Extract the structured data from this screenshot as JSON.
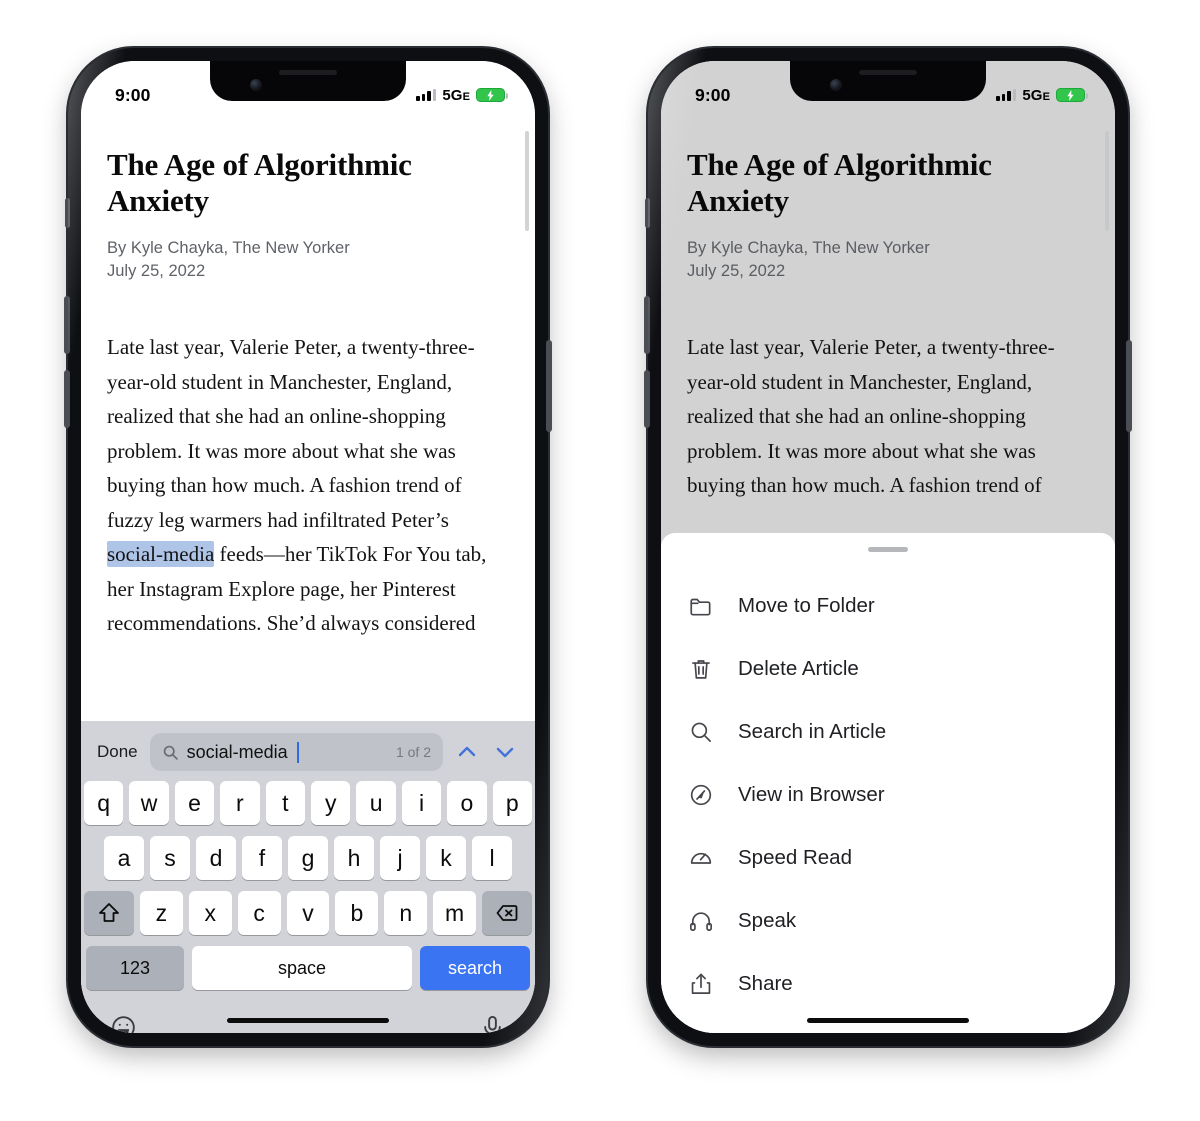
{
  "status_bar": {
    "time": "9:00",
    "network": "5G",
    "network_suffix": "E",
    "signal_icon": "signal-bars-icon",
    "battery_icon": "battery-charging-icon"
  },
  "article": {
    "title": "The Age of Algorithmic Anxiety",
    "byline": "By Kyle Chayka, The New Yorker",
    "date": "July 25, 2022",
    "body_before_highlight": "Late last year, Valerie Peter, a twenty-three-year-old student in Manchester, England, realized that she had an online-shopping problem. It was more about what she was buying than how much. A fashion trend of fuzzy leg warmers had infiltrated Peter’s ",
    "highlight": "social-media",
    "body_after_highlight": " feeds—her TikTok For You tab, her Instagram Explore page, her Pinterest recommendations. She’d always considered",
    "body_truncated": "Late last year, Valerie Peter, a twenty-three-year-old student in Manchester, England, realized that she had an online-shopping problem. It was more about what she was buying than how much. A fashion trend of",
    "highlight_color": "#aec5e8"
  },
  "find_bar": {
    "done_label": "Done",
    "search_icon": "magnifier-icon",
    "query": "social-media",
    "match_count": "1 of 2",
    "prev_icon": "chevron-up-icon",
    "next_icon": "chevron-down-icon",
    "accent_color": "#4472d8"
  },
  "keyboard": {
    "row1": [
      "q",
      "w",
      "e",
      "r",
      "t",
      "y",
      "u",
      "i",
      "o",
      "p"
    ],
    "row2": [
      "a",
      "s",
      "d",
      "f",
      "g",
      "h",
      "j",
      "k",
      "l"
    ],
    "row3": [
      "z",
      "x",
      "c",
      "v",
      "b",
      "n",
      "m"
    ],
    "shift_icon": "shift-arrow-icon",
    "backspace_icon": "backspace-icon",
    "numeric_label": "123",
    "space_label": "space",
    "return_label": "search",
    "return_color": "#3b74f2",
    "emoji_icon": "emoji-smiley-icon",
    "mic_icon": "microphone-icon"
  },
  "action_sheet": {
    "grabber": "sheet-grabber",
    "items": [
      {
        "label": "Move to Folder",
        "icon": "folder-icon"
      },
      {
        "label": "Delete Article",
        "icon": "trash-icon"
      },
      {
        "label": "Search in Article",
        "icon": "magnifier-icon"
      },
      {
        "label": "View in Browser",
        "icon": "compass-icon"
      },
      {
        "label": "Speed Read",
        "icon": "speedometer-icon"
      },
      {
        "label": "Speak",
        "icon": "headphones-icon"
      },
      {
        "label": "Share",
        "icon": "share-upload-icon"
      }
    ]
  }
}
